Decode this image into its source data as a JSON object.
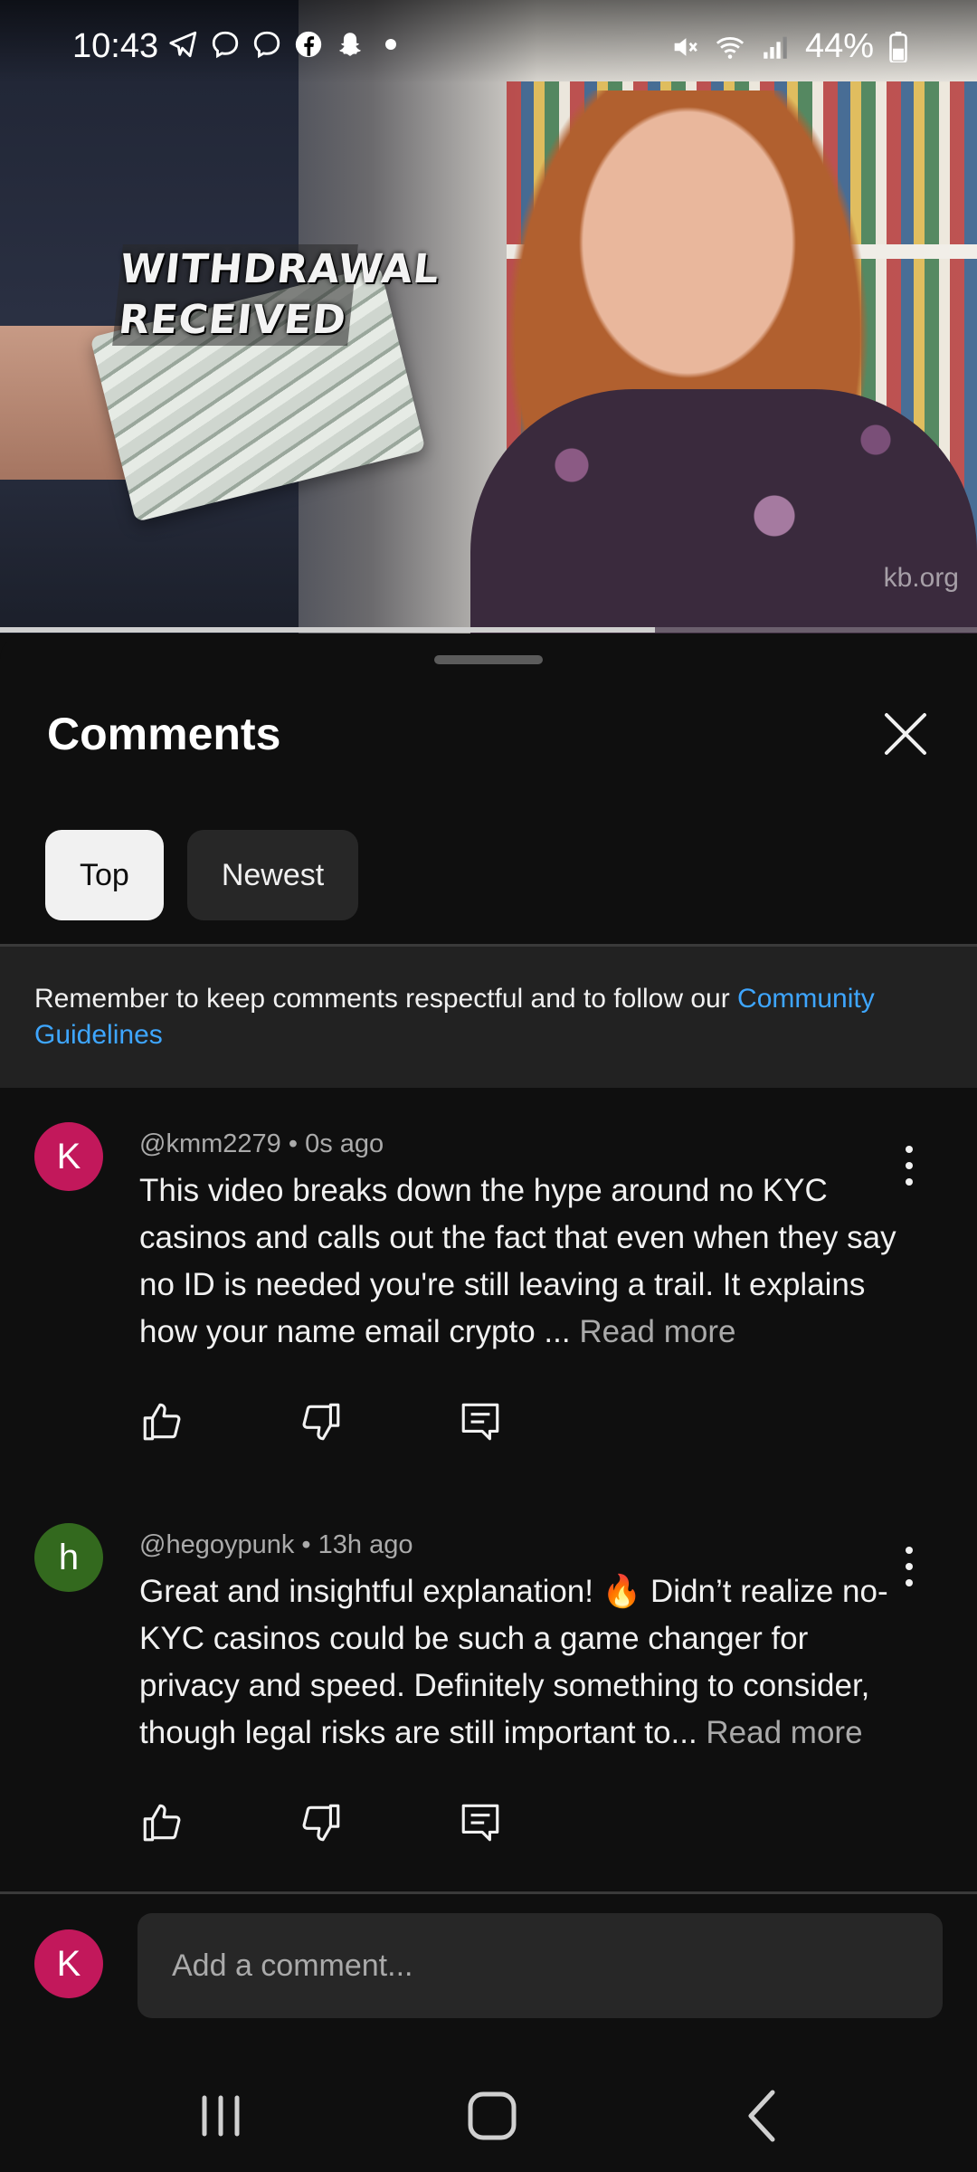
{
  "status_bar": {
    "time": "10:43",
    "left_icons": [
      "telegram-icon",
      "messenger-icon",
      "messenger-icon",
      "facebook-icon",
      "snapchat-icon",
      "dot-icon"
    ],
    "right_icons": [
      "mute-icon",
      "wifi-icon",
      "signal-icon",
      "battery-icon"
    ],
    "battery": "44%"
  },
  "video": {
    "overlay_line1": "WITHDRAWAL",
    "overlay_line2": "RECEIVED",
    "watermark": "kb.org",
    "progress_fraction": 0.67
  },
  "comments_panel": {
    "title": "Comments",
    "close_icon": "close-icon",
    "filters": [
      {
        "label": "Top",
        "selected": true
      },
      {
        "label": "Newest",
        "selected": false
      }
    ],
    "notice_text": "Remember to keep comments respectful and to follow our ",
    "notice_link": "Community Guidelines",
    "comments": [
      {
        "avatar_letter": "K",
        "avatar_color": "#c2185b",
        "handle": "@kmm2279",
        "time": "0s ago",
        "text": "This video breaks down the hype around no KYC casinos and calls out the fact that even when they say no ID is needed you're still leaving a trail. It explains how your name email crypto ... ",
        "read_more": "Read more"
      },
      {
        "avatar_letter": "h",
        "avatar_color": "#33691e",
        "handle": "@hegoypunk",
        "time": "13h ago",
        "text": "Great and insightful explanation! 🔥 Didn’t realize no-KYC casinos could be such a game changer for privacy and speed. Definitely something to consider, though legal risks are still important to... ",
        "read_more": "Read more"
      }
    ],
    "composer": {
      "avatar_letter": "K",
      "avatar_color": "#c2185b",
      "placeholder": "Add a comment..."
    }
  },
  "nav_bar": {
    "buttons": [
      "recents-icon",
      "home-icon",
      "back-icon"
    ]
  },
  "colors": {
    "background": "#0f0f0f",
    "link": "#3ea6ff",
    "chip_active": "#f1f1f1",
    "chip_inactive": "#272727"
  }
}
